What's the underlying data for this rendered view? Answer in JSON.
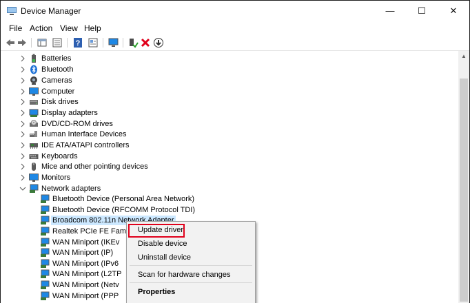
{
  "window": {
    "title": "Device Manager",
    "controls": {
      "minimize": "—",
      "maximize": "☐",
      "close": "✕"
    }
  },
  "menu": [
    "File",
    "Action",
    "View",
    "Help"
  ],
  "toolbar_icons": [
    "back-arrow-icon",
    "forward-arrow-icon",
    "properties-grid-icon",
    "view-list-icon",
    "help-icon",
    "show-hidden-icon",
    "scan-monitor-icon",
    "enable-device-icon",
    "uninstall-x-icon",
    "update-driver-icon"
  ],
  "tree": {
    "categories": [
      {
        "label": "Batteries",
        "icon": "battery-icon",
        "expanded": false
      },
      {
        "label": "Bluetooth",
        "icon": "bluetooth-icon",
        "expanded": false
      },
      {
        "label": "Cameras",
        "icon": "camera-icon",
        "expanded": false
      },
      {
        "label": "Computer",
        "icon": "monitor-icon",
        "expanded": false
      },
      {
        "label": "Disk drives",
        "icon": "disk-drive-icon",
        "expanded": false
      },
      {
        "label": "Display adapters",
        "icon": "display-adapter-icon",
        "expanded": false
      },
      {
        "label": "DVD/CD-ROM drives",
        "icon": "dvd-drive-icon",
        "expanded": false
      },
      {
        "label": "Human Interface Devices",
        "icon": "hid-icon",
        "expanded": false
      },
      {
        "label": "IDE ATA/ATAPI controllers",
        "icon": "ide-controller-icon",
        "expanded": false
      },
      {
        "label": "Keyboards",
        "icon": "keyboard-icon",
        "expanded": false
      },
      {
        "label": "Mice and other pointing devices",
        "icon": "mouse-icon",
        "expanded": false
      },
      {
        "label": "Monitors",
        "icon": "monitor-icon",
        "expanded": false
      },
      {
        "label": "Network adapters",
        "icon": "network-adapter-icon",
        "expanded": true
      }
    ],
    "network_children": [
      {
        "label": "Bluetooth Device (Personal Area Network)",
        "selected": false
      },
      {
        "label": "Bluetooth Device (RFCOMM Protocol TDI)",
        "selected": false
      },
      {
        "label": "Broadcom 802.11n Network Adapter",
        "selected": true
      },
      {
        "label": "Realtek PCIe FE Fam",
        "selected": false
      },
      {
        "label": "WAN Miniport (IKEv",
        "selected": false
      },
      {
        "label": "WAN Miniport (IP)",
        "selected": false
      },
      {
        "label": "WAN Miniport (IPv6",
        "selected": false
      },
      {
        "label": "WAN Miniport (L2TP",
        "selected": false
      },
      {
        "label": "WAN Miniport (Netv",
        "selected": false
      },
      {
        "label": "WAN Miniport (PPP",
        "selected": false
      }
    ]
  },
  "context_menu": {
    "items": [
      {
        "label": "Update driver",
        "bold": false,
        "highlighted": true
      },
      {
        "label": "Disable device",
        "bold": false,
        "highlighted": false
      },
      {
        "label": "Uninstall device",
        "bold": false,
        "highlighted": false
      },
      {
        "label": "Scan for hardware changes",
        "bold": false,
        "highlighted": false
      },
      {
        "label": "Properties",
        "bold": true,
        "highlighted": false
      }
    ],
    "highlight_color": "#e0001b"
  },
  "colors": {
    "selection": "#cce8ff",
    "monitor_blue": "#1e88e5"
  }
}
